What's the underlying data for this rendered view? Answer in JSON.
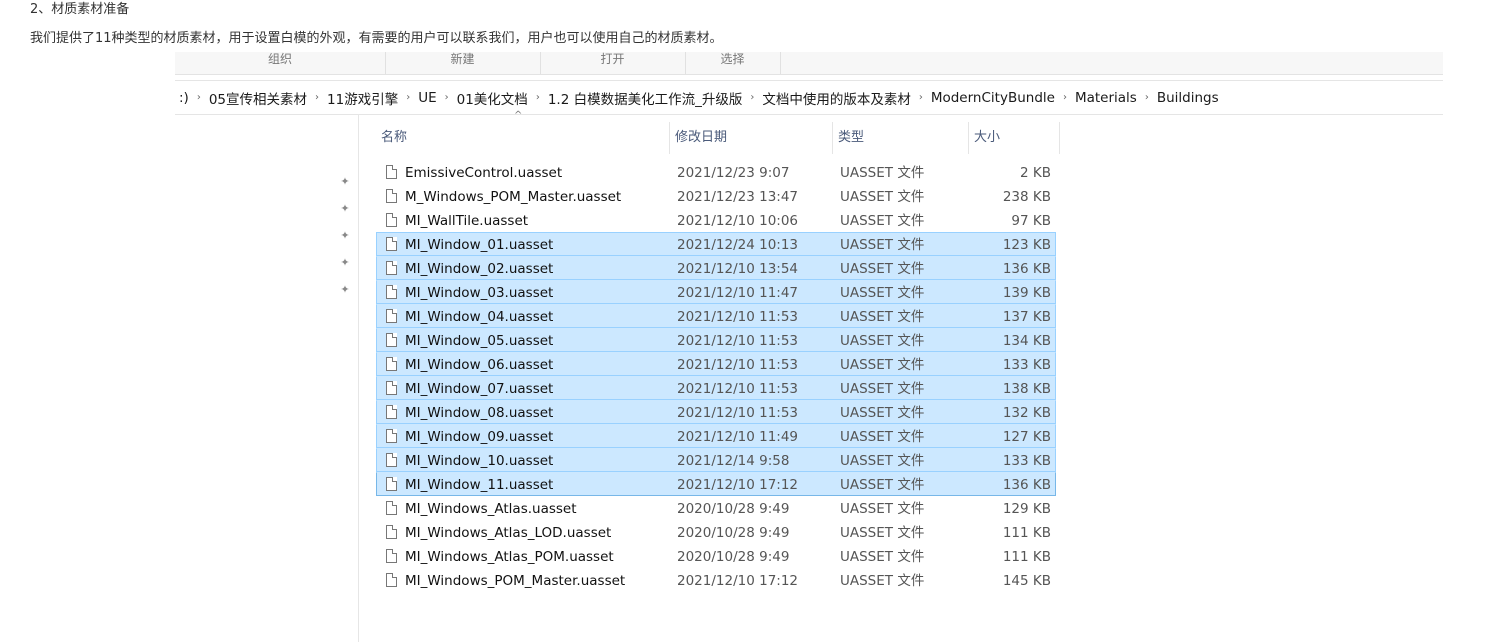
{
  "doc": {
    "heading": "2、材质素材准备",
    "intro": "我们提供了11种类型的材质素材，用于设置白模的外观，有需要的用户可以联系我们，用户也可以使用自己的材质素材。"
  },
  "ribbon": {
    "groups": [
      "组织",
      "新建",
      "打开",
      "选择"
    ]
  },
  "breadcrumb": [
    ":)",
    "05宣传相关素材",
    "11游戏引擎",
    "UE",
    "01美化文档",
    "1.2 白模数据美化工作流_升级版",
    "文档中使用的版本及素材",
    "ModernCityBundle",
    "Materials",
    "Buildings"
  ],
  "columns": {
    "name": "名称",
    "date": "修改日期",
    "type": "类型",
    "size": "大小"
  },
  "files": [
    {
      "name": "EmissiveControl.uasset",
      "date": "2021/12/23 9:07",
      "type": "UASSET 文件",
      "size": "2 KB"
    },
    {
      "name": "M_Windows_POM_Master.uasset",
      "date": "2021/12/23 13:47",
      "type": "UASSET 文件",
      "size": "238 KB"
    },
    {
      "name": "MI_WallTile.uasset",
      "date": "2021/12/10 10:06",
      "type": "UASSET 文件",
      "size": "97 KB"
    },
    {
      "name": "MI_Window_01.uasset",
      "date": "2021/12/24 10:13",
      "type": "UASSET 文件",
      "size": "123 KB"
    },
    {
      "name": "MI_Window_02.uasset",
      "date": "2021/12/10 13:54",
      "type": "UASSET 文件",
      "size": "136 KB"
    },
    {
      "name": "MI_Window_03.uasset",
      "date": "2021/12/10 11:47",
      "type": "UASSET 文件",
      "size": "139 KB"
    },
    {
      "name": "MI_Window_04.uasset",
      "date": "2021/12/10 11:53",
      "type": "UASSET 文件",
      "size": "137 KB"
    },
    {
      "name": "MI_Window_05.uasset",
      "date": "2021/12/10 11:53",
      "type": "UASSET 文件",
      "size": "134 KB"
    },
    {
      "name": "MI_Window_06.uasset",
      "date": "2021/12/10 11:53",
      "type": "UASSET 文件",
      "size": "133 KB"
    },
    {
      "name": "MI_Window_07.uasset",
      "date": "2021/12/10 11:53",
      "type": "UASSET 文件",
      "size": "138 KB"
    },
    {
      "name": "MI_Window_08.uasset",
      "date": "2021/12/10 11:53",
      "type": "UASSET 文件",
      "size": "132 KB"
    },
    {
      "name": "MI_Window_09.uasset",
      "date": "2021/12/10 11:49",
      "type": "UASSET 文件",
      "size": "127 KB"
    },
    {
      "name": "MI_Window_10.uasset",
      "date": "2021/12/14 9:58",
      "type": "UASSET 文件",
      "size": "133 KB"
    },
    {
      "name": "MI_Window_11.uasset",
      "date": "2021/12/10 17:12",
      "type": "UASSET 文件",
      "size": "136 KB"
    },
    {
      "name": "MI_Windows_Atlas.uasset",
      "date": "2020/10/28 9:49",
      "type": "UASSET 文件",
      "size": "129 KB"
    },
    {
      "name": "MI_Windows_Atlas_LOD.uasset",
      "date": "2020/10/28 9:49",
      "type": "UASSET 文件",
      "size": "111 KB"
    },
    {
      "name": "MI_Windows_Atlas_POM.uasset",
      "date": "2020/10/28 9:49",
      "type": "UASSET 文件",
      "size": "111 KB"
    },
    {
      "name": "MI_Windows_POM_Master.uasset",
      "date": "2021/12/10 17:12",
      "type": "UASSET 文件",
      "size": "145 KB"
    }
  ],
  "selection": {
    "first_index": 3,
    "last_index": 13,
    "color": "#cce8ff",
    "border_color": "#99d1ff"
  },
  "icons": {
    "file": "file-icon",
    "pin": "pin-icon",
    "sort": "sort-ascending-icon",
    "breadcrumb_separator": "chevron-right-icon"
  }
}
